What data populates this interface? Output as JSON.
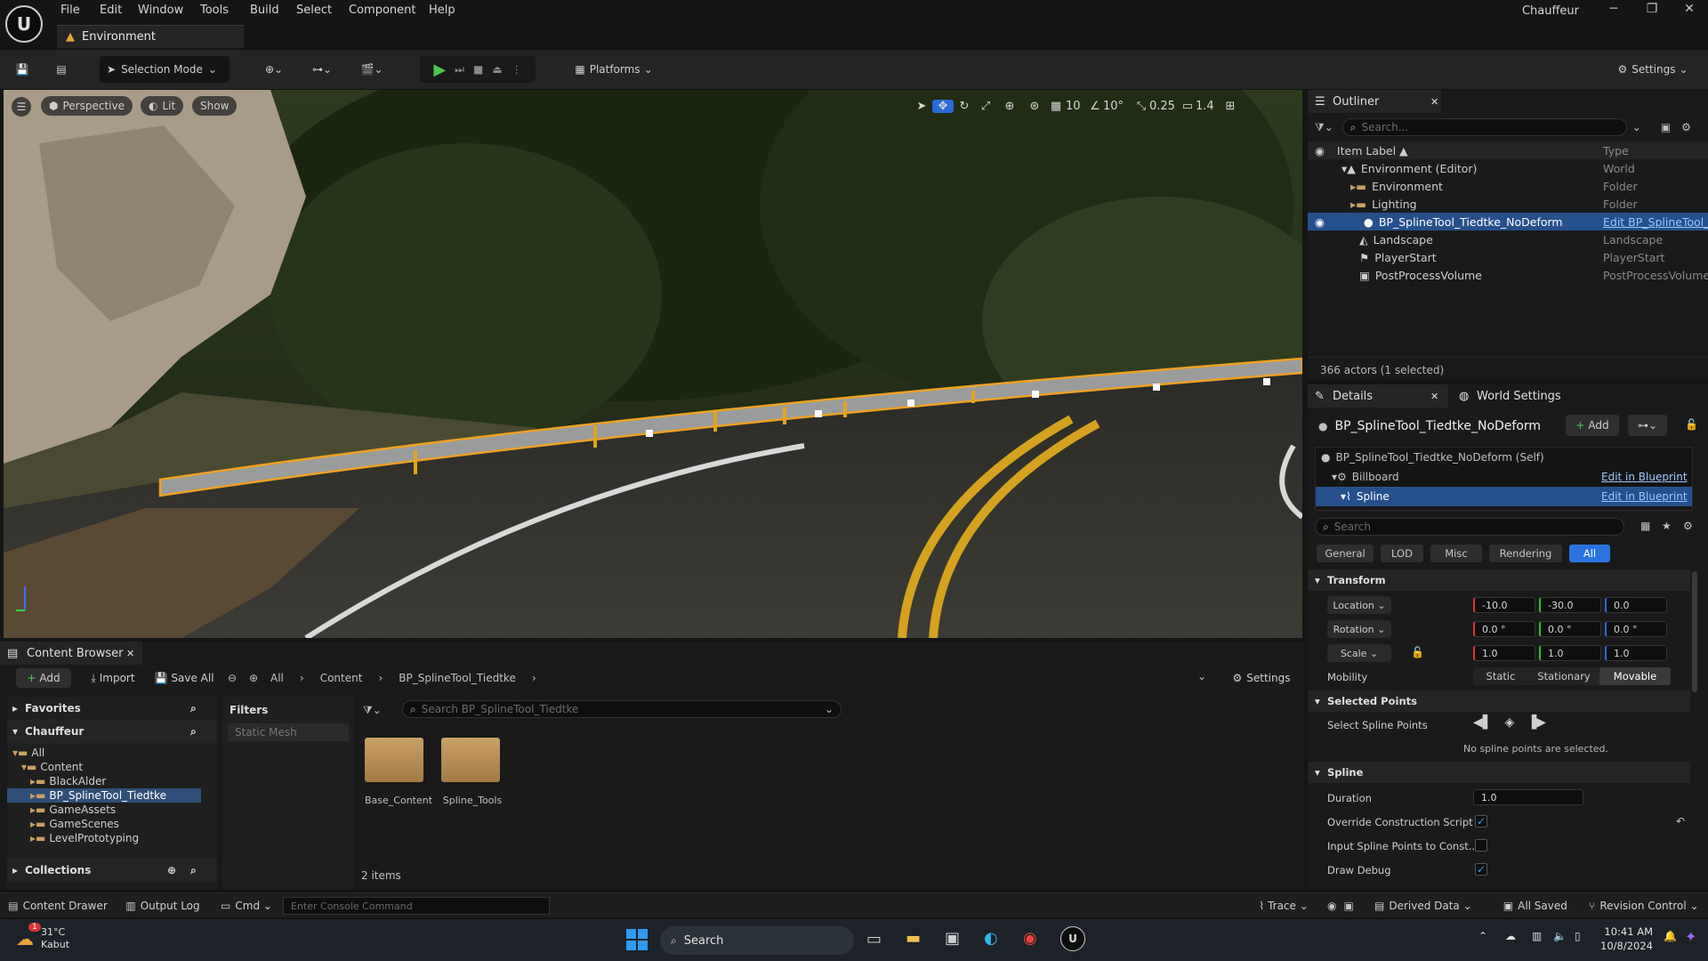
{
  "menu": [
    "File",
    "Edit",
    "Window",
    "Tools",
    "Build",
    "Select",
    "Component",
    "Help"
  ],
  "project_name": "Chauffeur",
  "level_tab": "Environment",
  "toolbar": {
    "selection_mode": "Selection Mode",
    "platforms": "Platforms",
    "settings": "Settings"
  },
  "viewport": {
    "perspective": "Perspective",
    "lit": "Lit",
    "show": "Show",
    "grid_snap": "10",
    "rot_snap": "10°",
    "scale_snap": "0.25",
    "cam_speed": "1.4"
  },
  "outliner": {
    "title": "Outliner",
    "search_placeholder": "Search...",
    "col_label": "Item Label ▲",
    "col_type": "Type",
    "rows": [
      {
        "label": "Environment (Editor)",
        "type": "World"
      },
      {
        "label": "Environment",
        "type": "Folder"
      },
      {
        "label": "Lighting",
        "type": "Folder"
      },
      {
        "label": "BP_SplineTool_Tiedtke_NoDeform",
        "type": "Edit BP_SplineTool_"
      },
      {
        "label": "Landscape",
        "type": "Landscape"
      },
      {
        "label": "PlayerStart",
        "type": "PlayerStart"
      },
      {
        "label": "PostProcessVolume",
        "type": "PostProcessVolume"
      }
    ],
    "status": "366 actors (1 selected)"
  },
  "details": {
    "tab": "Details",
    "tab2": "World Settings",
    "actor": "BP_SplineTool_Tiedtke_NoDeform",
    "add": "Add",
    "components": [
      {
        "label": "BP_SplineTool_Tiedtke_NoDeform (Self)",
        "link": ""
      },
      {
        "label": "Billboard",
        "link": "Edit in Blueprint"
      },
      {
        "label": "Spline",
        "link": "Edit in Blueprint"
      }
    ],
    "search_placeholder": "Search",
    "filters": [
      "General",
      "LOD",
      "Misc",
      "Rendering",
      "All"
    ],
    "transform": {
      "title": "Transform",
      "location_label": "Location",
      "rotation_label": "Rotation",
      "scale_label": "Scale",
      "location": [
        "-10.0",
        "-30.0",
        "0.0"
      ],
      "rotation": [
        "0.0 °",
        "0.0 °",
        "0.0 °"
      ],
      "scale": [
        "1.0",
        "1.0",
        "1.0"
      ],
      "mobility_label": "Mobility",
      "mobility": [
        "Static",
        "Stationary",
        "Movable"
      ]
    },
    "selected_points": {
      "title": "Selected Points",
      "label": "Select Spline Points",
      "empty": "No spline points are selected."
    },
    "spline": {
      "title": "Spline",
      "duration_label": "Duration",
      "duration": "1.0",
      "override_label": "Override Construction Script",
      "input_label": "Input Spline Points to Const...",
      "draw_debug_label": "Draw Debug"
    }
  },
  "content_browser": {
    "title": "Content Browser",
    "add": "Add",
    "import": "Import",
    "save_all": "Save All",
    "path": [
      "All",
      "Content",
      "BP_SplineTool_Tiedtke"
    ],
    "settings": "Settings",
    "favorites": "Favorites",
    "project": "Chauffeur",
    "filters": "Filters",
    "filter_item": "Static Mesh",
    "search_placeholder": "Search BP_SplineTool_Tiedtke",
    "tree": [
      "All",
      "Content",
      "BlackAlder",
      "BP_SplineTool_Tiedtke",
      "GameAssets",
      "GameScenes",
      "LevelPrototyping"
    ],
    "collections": "Collections",
    "folders": [
      "Base_Content",
      "Spline_Tools"
    ],
    "count": "2 items"
  },
  "statusbar": {
    "drawer": "Content Drawer",
    "output": "Output Log",
    "cmd": "Cmd",
    "console_placeholder": "Enter Console Command",
    "trace": "Trace",
    "derived": "Derived Data",
    "saved": "All Saved",
    "revision": "Revision Control"
  },
  "taskbar": {
    "temp": "31°C",
    "weather": "Kabut",
    "search": "Search",
    "time": "10:41 AM",
    "date": "10/8/2024",
    "badge": "1"
  }
}
